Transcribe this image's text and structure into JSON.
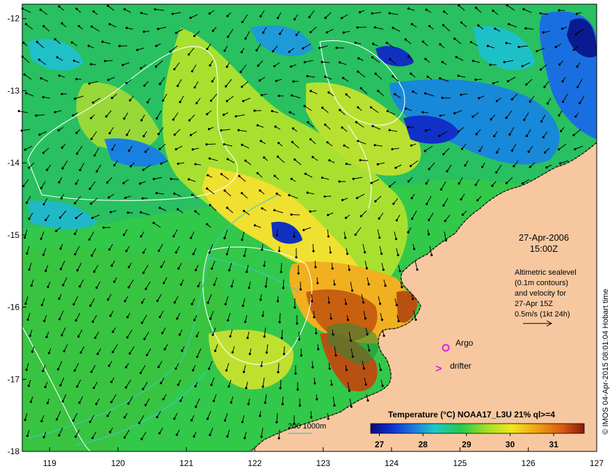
{
  "map": {
    "date": "27-Apr-2006",
    "time": "15:00Z",
    "note_lines": [
      "Altimetric sealevel",
      "(0.1m contours)",
      "and velocity for",
      "27-Apr 15Z",
      "0.5m/s (1kt 24h)"
    ],
    "argo_label": "Argo",
    "drifter_label": "drifter",
    "drifter_symbol": ">",
    "depth_legend": "200  1000m",
    "colorbar_title": "Temperature (°C) NOAA17_L3U 21% ql>=4",
    "colorbar_ticks": [
      "27",
      "28",
      "29",
      "30",
      "31"
    ],
    "credit": "© IMOS 04-Apr-2015 08:01:04 Hobart time",
    "lon_ticks": [
      "119",
      "120",
      "121",
      "122",
      "123",
      "124",
      "125",
      "126",
      "127"
    ],
    "lat_ticks": [
      "-12",
      "-13",
      "-14",
      "-15",
      "-16",
      "-17",
      "-18"
    ],
    "lon_range": [
      118.6,
      127
    ],
    "lat_range": [
      -11.8,
      -18
    ],
    "colors": {
      "land": "#f7c8a0",
      "argo": "#e020e0",
      "drifter": "#e020e0",
      "contour": "#ffffff",
      "isobath": "#40c8d0"
    }
  }
}
